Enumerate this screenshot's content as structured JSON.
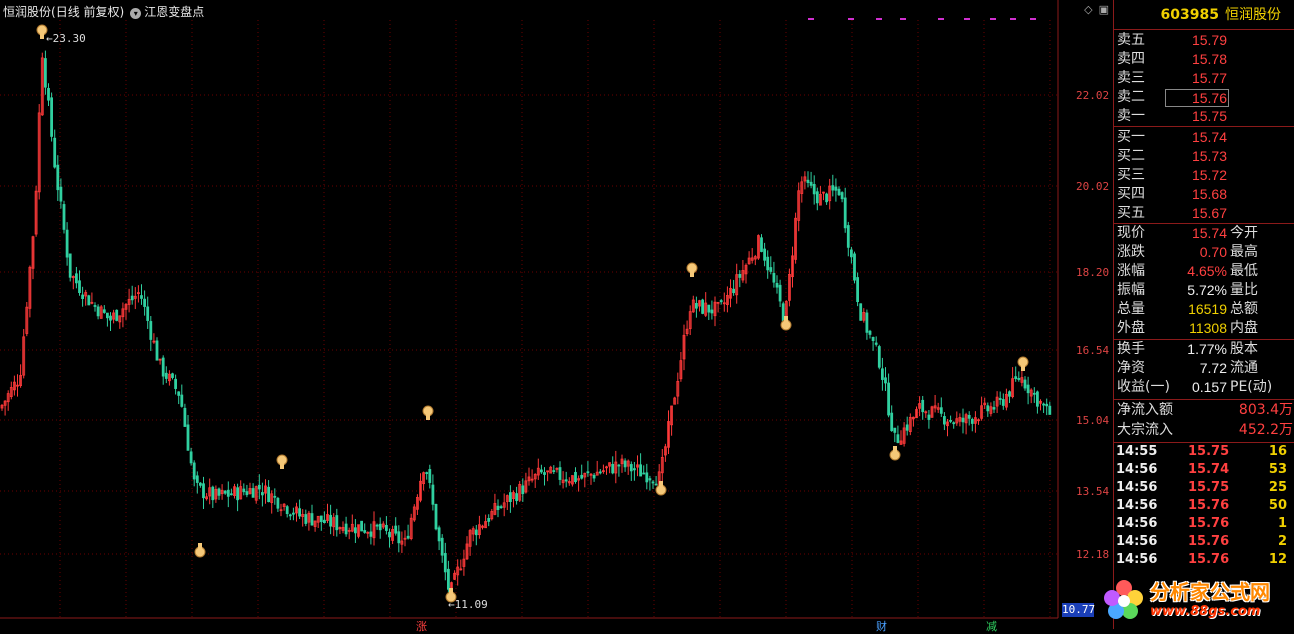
{
  "chart": {
    "title_stock": "恒润股份",
    "title_period": "(日线 前复权)",
    "indicator_name": "江恩变盘点",
    "price_axis": [
      "22.02",
      "20.02",
      "18.20",
      "16.54",
      "15.04",
      "13.54",
      "12.18"
    ],
    "current_price_box": "10.77",
    "high_label": "23.30",
    "low_label": "11.09",
    "bottom_marks": [
      "涨",
      "财",
      "减"
    ],
    "colors": {
      "up": "#ff3a3a",
      "down": "#30d0a0",
      "grid": "#6b0000",
      "axis_text": "#d44"
    }
  },
  "quote": {
    "code": "603985",
    "name": "恒润股份",
    "asks": [
      {
        "label": "卖五",
        "price": "15.79"
      },
      {
        "label": "卖四",
        "price": "15.78"
      },
      {
        "label": "卖三",
        "price": "15.77"
      },
      {
        "label": "卖二",
        "price": "15.76"
      },
      {
        "label": "卖一",
        "price": "15.75"
      }
    ],
    "bids": [
      {
        "label": "买一",
        "price": "15.74"
      },
      {
        "label": "买二",
        "price": "15.73"
      },
      {
        "label": "买三",
        "price": "15.72"
      },
      {
        "label": "买四",
        "price": "15.68"
      },
      {
        "label": "买五",
        "price": "15.67"
      }
    ],
    "stats": [
      {
        "label": "现价",
        "value": "15.74",
        "label2": "今开"
      },
      {
        "label": "涨跌",
        "value": "0.70",
        "label2": "最高"
      },
      {
        "label": "涨幅",
        "value": "4.65%",
        "label2": "最低"
      },
      {
        "label": "振幅",
        "value": "5.72%",
        "label2": "量比"
      },
      {
        "label": "总量",
        "value": "16519",
        "label2": "总额"
      },
      {
        "label": "外盘",
        "value": "11308",
        "label2": "内盘"
      }
    ],
    "stats2": [
      {
        "label": "换手",
        "value": "1.77%",
        "label2": "股本"
      },
      {
        "label": "净资",
        "value": "7.72",
        "label2": "流通"
      },
      {
        "label": "收益(一)",
        "value": "0.157",
        "label2": "PE(动)"
      }
    ],
    "flows": [
      {
        "label": "净流入额",
        "value": "803.4万"
      },
      {
        "label": "大宗流入",
        "value": "452.2万"
      }
    ],
    "ticks": [
      {
        "time": "14:55",
        "price": "15.75",
        "vol": "16"
      },
      {
        "time": "14:56",
        "price": "15.74",
        "vol": "53"
      },
      {
        "time": "14:56",
        "price": "15.75",
        "vol": "25"
      },
      {
        "time": "14:56",
        "price": "15.76",
        "vol": "50"
      },
      {
        "time": "14:56",
        "price": "15.76",
        "vol": "1"
      },
      {
        "time": "14:56",
        "price": "15.76",
        "vol": "2"
      },
      {
        "time": "14:56",
        "price": "15.76",
        "vol": "12"
      }
    ]
  },
  "watermark": {
    "text": "分析家公式网",
    "url": "www.88gs.com"
  }
}
